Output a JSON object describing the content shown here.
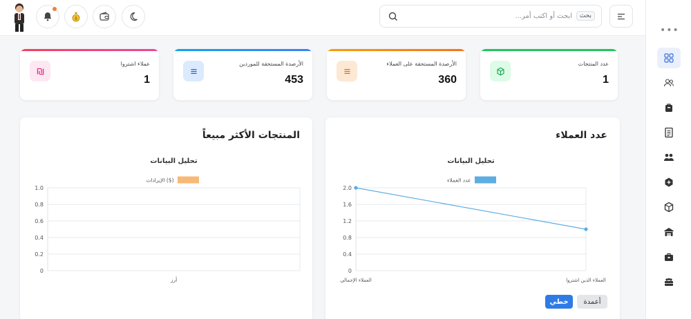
{
  "header": {
    "search_placeholder": "ابحث أو اكتب أمر...",
    "search_shortcut": "بحث"
  },
  "stats": [
    {
      "label": "عدد المنتجات",
      "value": "1",
      "color": "#22c55e"
    },
    {
      "label": "الأرصدة المستحقة على العملاء",
      "value": "360",
      "color": "#f59e0b"
    },
    {
      "label": "الأرصدة المستحقة للموردين",
      "value": "453",
      "color": "#3b82f6"
    },
    {
      "label": "عملاء اشتروا",
      "value": "1",
      "color": "#ec4899"
    }
  ],
  "customers_panel": {
    "title": "عدد العملاء",
    "chart_title": "تحليل البيانات",
    "buttons": {
      "line": "خطي",
      "bars": "أعمدة"
    }
  },
  "products_panel": {
    "title": "المنتجات الأكثر مبيعاً",
    "chart_title": "تحليل البيانات"
  },
  "chart_data": [
    {
      "type": "line",
      "title": "تحليل البيانات",
      "categories": [
        "العملاء الإجمالي",
        "العملاء الذين اشتروا"
      ],
      "series": [
        {
          "name": "عدد العملاء",
          "values": [
            2,
            1
          ],
          "color": "#5dade2"
        }
      ],
      "ylim": [
        0,
        2.0
      ],
      "yticks": [
        "0",
        "0.4",
        "0.8",
        "1.2",
        "1.6",
        "2.0"
      ],
      "grid": true,
      "legend": "top"
    },
    {
      "type": "bar",
      "title": "تحليل البيانات",
      "categories": [
        "أرز"
      ],
      "series": [
        {
          "name": "الإيرادات ($)",
          "values": [],
          "color": "#f8b878"
        }
      ],
      "ylim": [
        0,
        1.0
      ],
      "yticks": [
        "0",
        "0.2",
        "0.4",
        "0.6",
        "0.8",
        "1.0"
      ],
      "grid": true,
      "legend": "top"
    }
  ]
}
